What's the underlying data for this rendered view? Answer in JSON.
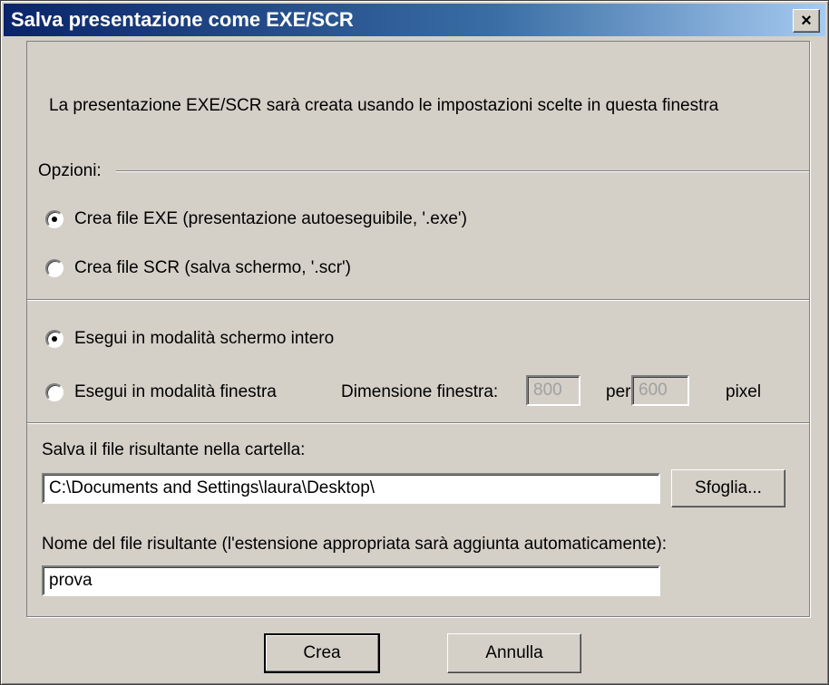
{
  "window": {
    "title": "Salva presentazione come EXE/SCR",
    "close_label": "×"
  },
  "intro": "La presentazione EXE/SCR sarà creata usando le impostazioni scelte in questa finestra",
  "options": {
    "group_label": "Opzioni:",
    "file_type": [
      {
        "label": "Crea file EXE (presentazione autoeseguibile, '.exe')",
        "selected": true
      },
      {
        "label": "Crea file SCR (salva schermo, '.scr')",
        "selected": false
      }
    ],
    "mode": [
      {
        "label": "Esegui in modalità schermo intero",
        "selected": true
      },
      {
        "label": "Esegui in modalità finestra",
        "selected": false
      }
    ],
    "window_size": {
      "label": "Dimensione finestra:",
      "width": "800",
      "by_label": "per",
      "height": "600",
      "unit": "pixel"
    }
  },
  "output": {
    "folder_label": "Salva il file risultante nella cartella:",
    "folder_value": "C:\\Documents and Settings\\laura\\Desktop\\",
    "browse_label": "Sfoglia...",
    "filename_label": "Nome del file risultante (l'estensione appropriata sarà aggiunta automaticamente):",
    "filename_value": "prova"
  },
  "buttons": {
    "create": "Crea",
    "cancel": "Annulla"
  }
}
